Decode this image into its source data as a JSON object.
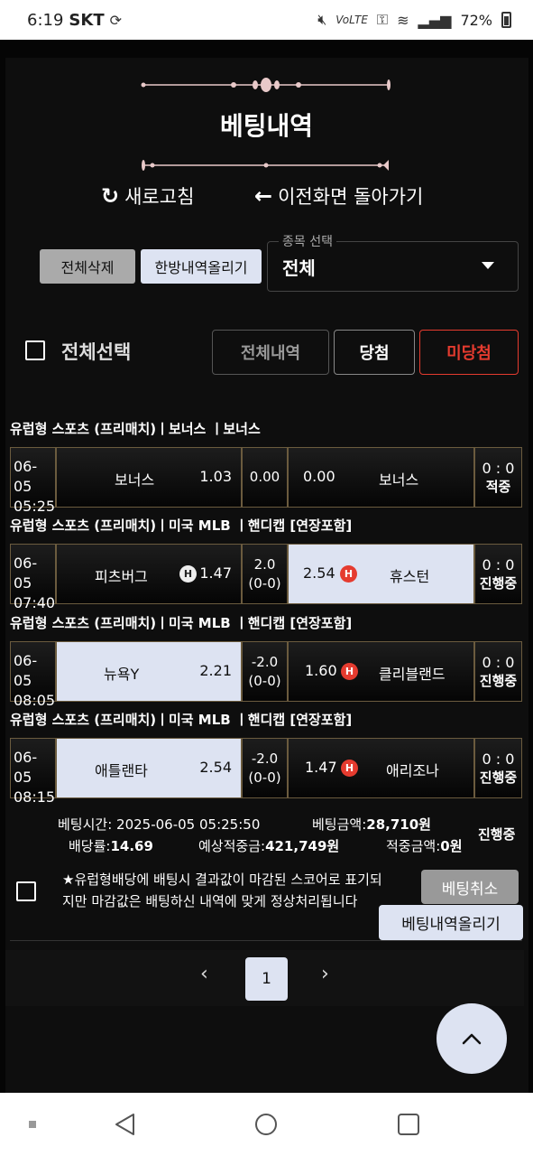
{
  "status_bar": {
    "time": "6:19",
    "carrier": "SKT",
    "battery": "72%",
    "volte": "VoLTE"
  },
  "header": {
    "title": "베팅내역"
  },
  "nav": {
    "refresh": "새로고침",
    "back": "이전화면 돌아가기"
  },
  "actions": {
    "delete_all": "전체삭제",
    "upload_single": "한방내역올리기"
  },
  "sport_select": {
    "label": "종목 선택",
    "value": "전체"
  },
  "filters": {
    "select_all": "전체선택",
    "all": "전체내역",
    "win": "당첨",
    "lose": "미당첨"
  },
  "bets": [
    {
      "league": "유럽형 스포츠 (프리매치)ㅣ보너스 ㅣ보너스",
      "date": "06-05",
      "time": "05:25",
      "home_team": "보너스",
      "home_odds": "1.03",
      "line": "0.00",
      "away_odds": "0.00",
      "away_team": "보너스",
      "score": "0 : 0",
      "status": "적중"
    },
    {
      "league": "유럽형 스포츠 (프리매치)ㅣ미국 MLB ㅣ핸디캡 [연장포함]",
      "date": "06-05",
      "time": "07:40",
      "home_team": "피츠버그",
      "home_badge": "H",
      "home_odds": "1.47",
      "line": "2.0 (0-0)",
      "away_odds": "2.54",
      "away_badge": "H",
      "away_team": "휴스턴",
      "score": "0 : 0",
      "status": "진행중"
    },
    {
      "league": "유럽형 스포츠 (프리매치)ㅣ미국 MLB ㅣ핸디캡 [연장포함]",
      "date": "06-05",
      "time": "08:05",
      "home_team": "뉴욕Y",
      "home_odds": "2.21",
      "line": "-2.0 (0-0)",
      "away_odds": "1.60",
      "away_badge": "H",
      "away_team": "클리블랜드",
      "score": "0 : 0",
      "status": "진행중"
    },
    {
      "league": "유럽형 스포츠 (프리매치)ㅣ미국 MLB ㅣ핸디캡 [연장포함]",
      "date": "06-05",
      "time": "08:15",
      "home_team": "애틀랜타",
      "home_odds": "2.54",
      "line": "-2.0 (0-0)",
      "away_odds": "1.47",
      "away_badge": "H",
      "away_team": "애리조나",
      "score": "0 : 0",
      "status": "진행중"
    }
  ],
  "summary": {
    "bet_time_label": "베팅시간:",
    "bet_time": "2025-06-05 05:25:50",
    "bet_amount_label": "베팅금액:",
    "bet_amount": "28,710원",
    "odds_label": "배당률:",
    "odds": "14.69",
    "expected_label": "예상적중금:",
    "expected": "421,749원",
    "won_label": "적중금액:",
    "won": "0원",
    "status": "진행중"
  },
  "notice": "★유럽형배당에 배팅시 결과값이 마감된 스코어로 표기되지만 마감값은 배팅하신 내역에 맞게 정상처리됩니다",
  "buttons": {
    "cancel": "베팅취소",
    "upload": "베팅내역올리기"
  },
  "pagination": {
    "prev": "‹",
    "current": "1",
    "next": "›"
  },
  "colors": {
    "selected_cell": "#dde3f2",
    "lose_red": "#e53b2f",
    "cell_border": "#6b5b3e"
  }
}
